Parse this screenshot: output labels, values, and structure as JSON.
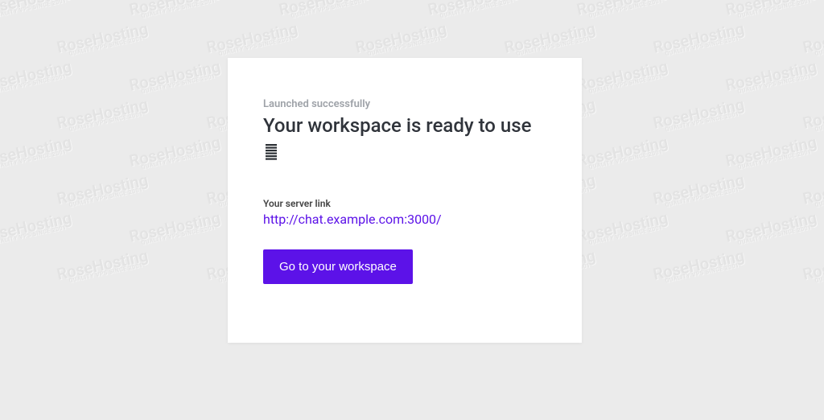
{
  "watermark": {
    "name": "RoseHosting",
    "tagline": "QUALITY VPS SINCE 2001"
  },
  "card": {
    "status": "Launched successfully",
    "heading": "Your workspace is ready to use",
    "server_label": "Your server link",
    "server_url": "http://chat.example.com:3000/",
    "cta": "Go to your workspace"
  }
}
